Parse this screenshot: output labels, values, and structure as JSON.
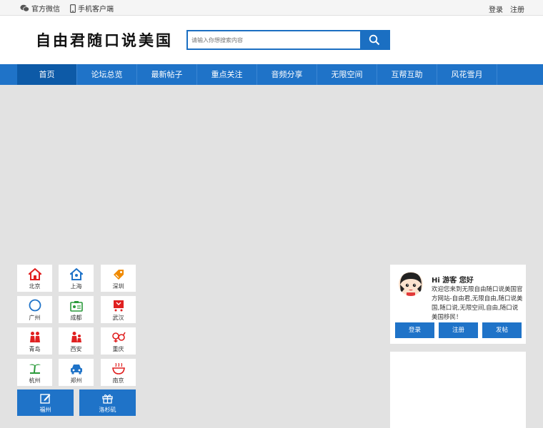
{
  "topbar": {
    "wechat_label": "官方微信",
    "mobile_label": "手机客户端",
    "login": "登录",
    "register": "注册"
  },
  "header": {
    "logo_text": "自由君随口说美国",
    "search_placeholder": "请输入你想搜索内容"
  },
  "nav": {
    "items": [
      "首页",
      "论坛总览",
      "最新帖子",
      "重点关注",
      "音频分享",
      "无限空间",
      "互帮互助",
      "风花雪月"
    ]
  },
  "cities": {
    "items": [
      {
        "label": "北京",
        "icon": "house-icon",
        "color": "#e02020"
      },
      {
        "label": "上海",
        "icon": "house-icon",
        "color": "#1f73c8"
      },
      {
        "label": "深圳",
        "icon": "shopping-tag-icon",
        "color": "#f08a00"
      },
      {
        "label": "广州",
        "icon": "circle-icon",
        "color": "#1f73c8"
      },
      {
        "label": "成都",
        "icon": "id-card-icon",
        "color": "#2a9a3a"
      },
      {
        "label": "武汉",
        "icon": "shopping-cart-icon",
        "color": "#e02020"
      },
      {
        "label": "青岛",
        "icon": "couple-icon",
        "color": "#e02020"
      },
      {
        "label": "西安",
        "icon": "family-icon",
        "color": "#e02020"
      },
      {
        "label": "重庆",
        "icon": "gender-icon",
        "color": "#e02020"
      },
      {
        "label": "杭州",
        "icon": "palm-tree-icon",
        "color": "#2a9a3a"
      },
      {
        "label": "郑州",
        "icon": "car-icon",
        "color": "#1f73c8"
      },
      {
        "label": "南京",
        "icon": "bowl-icon",
        "color": "#e02020"
      }
    ],
    "big_items": [
      {
        "label": "福州",
        "icon": "edit-icon"
      },
      {
        "label": "洛杉矶",
        "icon": "gift-icon"
      }
    ]
  },
  "panel": {
    "greeting": "Hi 游客 您好",
    "welcome": "欢迎您来到无限自由随口说美国官方网站-自由君,无限自由,随口说美国,随口说,无限空间,自由,随口说美国移民！",
    "buttons": [
      "登录",
      "注册",
      "发帖"
    ]
  },
  "colors": {
    "accent": "#1f73c8",
    "nav_active": "#0d5aa7",
    "background": "#e2e2e2"
  }
}
